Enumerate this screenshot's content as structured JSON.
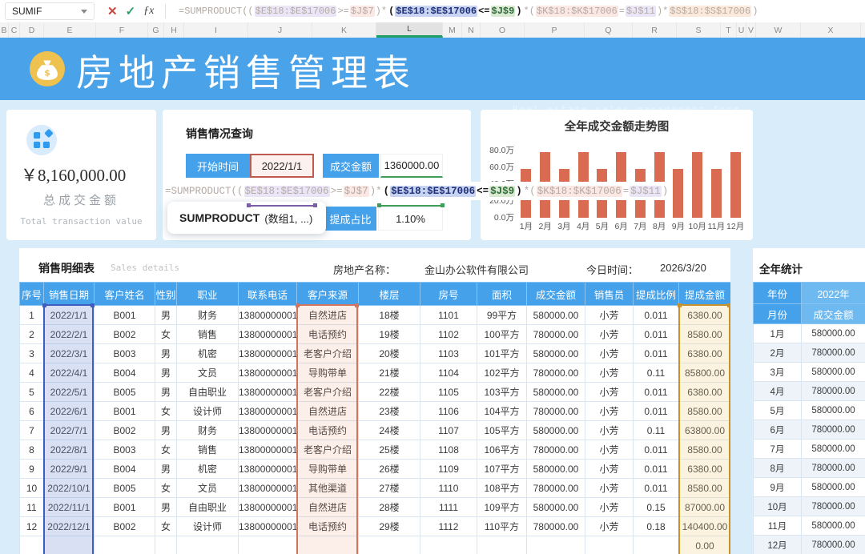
{
  "toolbar": {
    "name_box": "SUMIF",
    "cancel_icon": "✕",
    "confirm_icon": "✓",
    "fx_icon": "ƒx"
  },
  "formula_tokens": [
    {
      "t": "=SUMPRODUCT((",
      "c": "dim"
    },
    {
      "t": "$E$18:$E$17006",
      "c": "dim hl-lav"
    },
    {
      "t": ">=",
      "c": "dim"
    },
    {
      "t": "$J$7",
      "c": "dim hl-pink"
    },
    {
      "t": ")*",
      "c": "dim"
    },
    {
      "t": "(",
      "c": "strong"
    },
    {
      "t": "$E$18:$E$17006",
      "c": "strong hl-blue"
    },
    {
      "t": "<=",
      "c": "strong"
    },
    {
      "t": "$J$9",
      "c": "strong hl-green"
    },
    {
      "t": ")",
      "c": "strong"
    },
    {
      "t": "*(",
      "c": "dim"
    },
    {
      "t": "$K$18:$K$17006",
      "c": "dim hl-pink"
    },
    {
      "t": "=",
      "c": "dim"
    },
    {
      "t": "$J$11",
      "c": "dim hl-lav"
    },
    {
      "t": ")*",
      "c": "dim"
    },
    {
      "t": "$S$18:$S$17006",
      "c": "dim hl-orange"
    },
    {
      "t": ")",
      "c": "dim"
    }
  ],
  "columns_strip": {
    "letters": [
      "B",
      "C",
      "D",
      "E",
      "F",
      "G",
      "H",
      "I",
      "J",
      "K",
      "L",
      "M",
      "N",
      "O",
      "P",
      "Q",
      "R",
      "S",
      "T",
      "U",
      "V",
      "W",
      "X"
    ],
    "active": "L"
  },
  "banner": {
    "title": "房地产销售管理表",
    "subtitle": "Real estate sales management form",
    "icon": "money-bag-icon"
  },
  "summary_card": {
    "amount": "￥8,160,000.00",
    "label_cn": "总成交金额",
    "label_en": "Total transaction value",
    "icon": "tiles-icon"
  },
  "query": {
    "title": "销售情况查询",
    "start_label": "开始时间",
    "start_value": "2022/1/1",
    "amount_label": "成交金额",
    "amount_value": "1360000.00",
    "ratio_label": "提成占比",
    "ratio_value": "1.10%",
    "tooltip_fn": "SUMPRODUCT",
    "tooltip_args": "(数组1, ...)"
  },
  "chart_data": {
    "type": "bar",
    "title": "全年成交金额走势图",
    "categories": [
      "1月",
      "2月",
      "3月",
      "4月",
      "5月",
      "6月",
      "7月",
      "8月",
      "9月",
      "10月",
      "11月",
      "12月"
    ],
    "values": [
      58,
      78,
      58,
      78,
      58,
      78,
      58,
      78,
      58,
      78,
      58,
      78
    ],
    "unit": "万",
    "ylabel": "",
    "xlabel": "",
    "ylim": [
      0,
      80
    ],
    "yticks": [
      "80.0万",
      "60.0万",
      "40.0万",
      "20.0万",
      "0.0万"
    ],
    "grid": false,
    "legend": "none",
    "bar_color": "#d96b52"
  },
  "details": {
    "title": "销售明细表",
    "subtitle": "Sales details",
    "property_label": "房地产名称：",
    "property_value": "金山办公软件有限公司",
    "date_label": "今日时间：",
    "date_value": "2026/3/20",
    "headers": [
      "序号",
      "销售日期",
      "客户姓名",
      "性别",
      "职业",
      "联系电话",
      "客户来源",
      "楼层",
      "房号",
      "面积",
      "成交金额",
      "销售员",
      "提成比例",
      "提成金额"
    ],
    "rows": [
      [
        "1",
        "2022/1/1",
        "B001",
        "男",
        "财务",
        "13800000001",
        "自然进店",
        "18楼",
        "1101",
        "99平方",
        "580000.00",
        "小芳",
        "0.011",
        "6380.00"
      ],
      [
        "2",
        "2022/2/1",
        "B002",
        "女",
        "销售",
        "13800000001",
        "电话预约",
        "19楼",
        "1102",
        "100平方",
        "780000.00",
        "小芳",
        "0.011",
        "8580.00"
      ],
      [
        "3",
        "2022/3/1",
        "B003",
        "男",
        "机密",
        "13800000001",
        "老客户介绍",
        "20楼",
        "1103",
        "101平方",
        "580000.00",
        "小芳",
        "0.011",
        "6380.00"
      ],
      [
        "4",
        "2022/4/1",
        "B004",
        "男",
        "文员",
        "13800000001",
        "导购带单",
        "21楼",
        "1104",
        "102平方",
        "780000.00",
        "小芳",
        "0.11",
        "85800.00"
      ],
      [
        "5",
        "2022/5/1",
        "B005",
        "男",
        "自由职业",
        "13800000001",
        "老客户介绍",
        "22楼",
        "1105",
        "103平方",
        "580000.00",
        "小芳",
        "0.011",
        "6380.00"
      ],
      [
        "6",
        "2022/6/1",
        "B001",
        "女",
        "设计师",
        "13800000001",
        "自然进店",
        "23楼",
        "1106",
        "104平方",
        "780000.00",
        "小芳",
        "0.011",
        "8580.00"
      ],
      [
        "7",
        "2022/7/1",
        "B002",
        "男",
        "财务",
        "13800000001",
        "电话预约",
        "24楼",
        "1107",
        "105平方",
        "580000.00",
        "小芳",
        "0.11",
        "63800.00"
      ],
      [
        "8",
        "2022/8/1",
        "B003",
        "女",
        "销售",
        "13800000001",
        "老客户介绍",
        "25楼",
        "1108",
        "106平方",
        "780000.00",
        "小芳",
        "0.011",
        "8580.00"
      ],
      [
        "9",
        "2022/9/1",
        "B004",
        "男",
        "机密",
        "13800000001",
        "导购带单",
        "26楼",
        "1109",
        "107平方",
        "580000.00",
        "小芳",
        "0.011",
        "6380.00"
      ],
      [
        "10",
        "2022/10/1",
        "B005",
        "女",
        "文员",
        "13800000001",
        "其他渠道",
        "27楼",
        "1110",
        "108平方",
        "780000.00",
        "小芳",
        "0.011",
        "8580.00"
      ],
      [
        "11",
        "2022/11/1",
        "B001",
        "男",
        "自由职业",
        "13800000001",
        "自然进店",
        "28楼",
        "1111",
        "109平方",
        "580000.00",
        "小芳",
        "0.15",
        "87000.00"
      ],
      [
        "12",
        "2022/12/1",
        "B002",
        "女",
        "设计师",
        "13800000001",
        "电话预约",
        "29楼",
        "1112",
        "110平方",
        "780000.00",
        "小芳",
        "0.18",
        "140400.00"
      ],
      [
        "",
        "",
        "",
        "",
        "",
        "",
        "",
        "",
        "",
        "",
        "",
        "",
        "",
        "0.00"
      ]
    ]
  },
  "annual": {
    "title": "全年统计",
    "year_label": "年份",
    "year_value": "2022年",
    "month_label": "月份",
    "amount_label": "成交金额",
    "rows": [
      [
        "1月",
        "580000.00"
      ],
      [
        "2月",
        "780000.00"
      ],
      [
        "3月",
        "580000.00"
      ],
      [
        "4月",
        "780000.00"
      ],
      [
        "5月",
        "580000.00"
      ],
      [
        "6月",
        "780000.00"
      ],
      [
        "7月",
        "580000.00"
      ],
      [
        "8月",
        "780000.00"
      ],
      [
        "9月",
        "580000.00"
      ],
      [
        "10月",
        "780000.00"
      ],
      [
        "11月",
        "580000.00"
      ],
      [
        "12月",
        "780000.00"
      ]
    ]
  },
  "colors": {
    "banner_blue": "#4aa2e9",
    "header_blue": "#45a2ea",
    "header_blue_light": "#6fb9f1",
    "page_bg": "#d8ecf9",
    "bar_orange": "#d96b52",
    "select_blue": "#3f5cc0",
    "select_red": "#d4735e",
    "select_orange": "#c8912c",
    "active_col_green": "#1f9e63"
  }
}
